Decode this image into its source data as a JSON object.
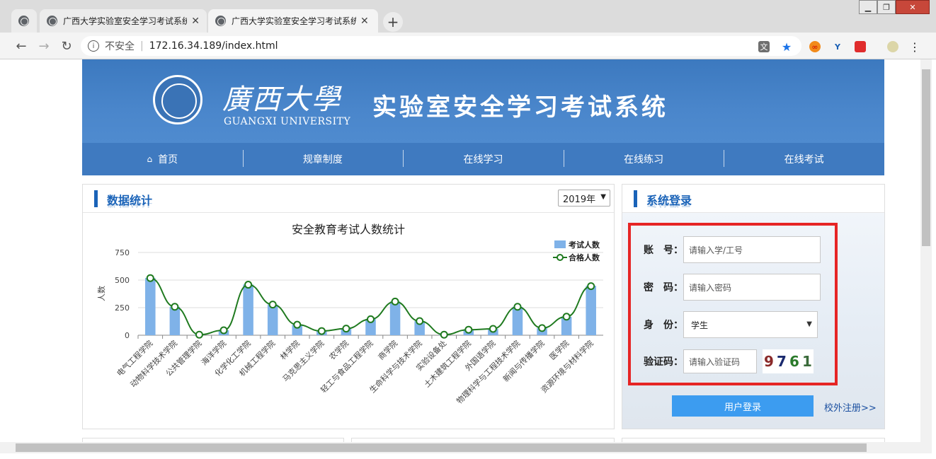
{
  "browser": {
    "tabs": [
      {
        "label": "",
        "active": false
      },
      {
        "label": "广西大学实验室安全学习考试系统",
        "active": false
      },
      {
        "label": "广西大学实验室安全学习考试系统",
        "active": true
      }
    ],
    "new_tab_label": "+",
    "address": {
      "security_label": "不安全",
      "url": "172.16.34.189/index.html"
    },
    "window_buttons": {
      "minimize": "▁",
      "maximize": "❐",
      "close": "✕"
    }
  },
  "header": {
    "university_cn": "廣西大學",
    "university_en": "GUANGXI UNIVERSITY",
    "system_title": "实验室安全学习考试系统"
  },
  "nav": {
    "items": [
      "首页",
      "规章制度",
      "在线学习",
      "在线练习",
      "在线考试"
    ],
    "home_icon": "home-icon"
  },
  "stats_panel": {
    "title": "数据统计",
    "year_select": "2019年"
  },
  "chart_data": {
    "type": "bar",
    "title": "安全教育考试人数统计",
    "ylabel": "人数",
    "xlabel": "",
    "ylim": [
      0,
      750
    ],
    "yticks": [
      0,
      250,
      500,
      750
    ],
    "legend_position": "top-right",
    "categories": [
      "电气工程学院",
      "动物科学技术学院",
      "公共管理学院",
      "海洋学院",
      "化学化工学院",
      "机械工程学院",
      "林学院",
      "马克思主义学院",
      "农学院",
      "轻工与食品工程学院",
      "商学院",
      "生命科学与技术学院",
      "实验设备处",
      "土木建筑工程学院",
      "外国语学院",
      "物理科学与工程技术学院",
      "新闻与传播学院",
      "医学院",
      "资源环境与材料学院"
    ],
    "series": [
      {
        "name": "考试人数",
        "type": "bar",
        "color": "#7fb2e8",
        "values": [
          520,
          258,
          5,
          45,
          460,
          278,
          95,
          38,
          60,
          148,
          305,
          128,
          5,
          50,
          58,
          258,
          65,
          168,
          448
        ]
      },
      {
        "name": "合格人数",
        "type": "line",
        "color": "#1f7a1f",
        "values": [
          518,
          258,
          5,
          45,
          458,
          278,
          95,
          38,
          60,
          145,
          305,
          128,
          5,
          50,
          58,
          258,
          65,
          168,
          445
        ]
      }
    ]
  },
  "login_panel": {
    "title": "系统登录",
    "account_label": "账　号：",
    "account_placeholder": "请输入学/工号",
    "password_label": "密　码：",
    "password_placeholder": "请输入密码",
    "role_label": "身　份：",
    "role_value": "学生",
    "captcha_label": "验证码：",
    "captcha_placeholder": "请输入验证码",
    "captcha_chars": [
      "9",
      "7",
      "6",
      "1"
    ],
    "login_button": "用户登录",
    "register_link": "校外注册>>"
  }
}
